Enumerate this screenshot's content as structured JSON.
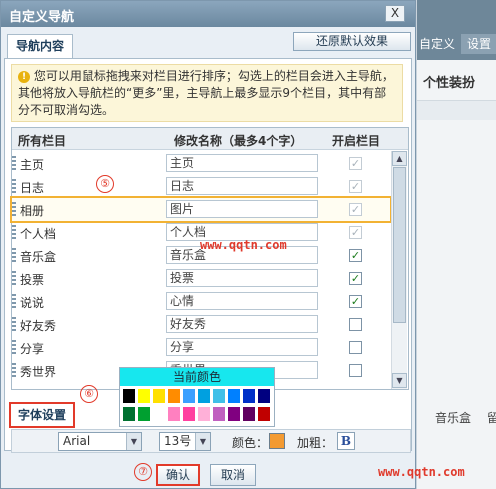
{
  "dialog": {
    "title": "自定义导航",
    "close_label": "X",
    "tab_label": "导航内容",
    "restore_label": "还原默认效果",
    "tip_icon": "!",
    "tip": "您可以用鼠标拖拽来对栏目进行排序；勾选上的栏目会进入主导航，其他将放入导航栏的“更多”里，主导航上最多显示9个栏目，其中有部分不可取消勾选。",
    "columns": {
      "all": "所有栏目",
      "rename": "修改名称（最多4个字）",
      "enable": "开启栏目"
    },
    "rows": [
      {
        "label": "主页",
        "name": "主页",
        "checked": true,
        "disabled": true
      },
      {
        "label": "日志",
        "name": "日志",
        "checked": true,
        "disabled": true
      },
      {
        "label": "相册",
        "name": "图片",
        "checked": true,
        "disabled": true,
        "highlight": true
      },
      {
        "label": "个人档",
        "name": "个人档",
        "checked": true,
        "disabled": true
      },
      {
        "label": "音乐盒",
        "name": "音乐盒",
        "checked": true,
        "disabled": false
      },
      {
        "label": "投票",
        "name": "投票",
        "checked": true,
        "disabled": false
      },
      {
        "label": "说说",
        "name": "心情",
        "checked": true,
        "disabled": false
      },
      {
        "label": "好友秀",
        "name": "好友秀",
        "checked": false,
        "disabled": false
      },
      {
        "label": "分享",
        "name": "分享",
        "checked": false,
        "disabled": false
      },
      {
        "label": "秀世界",
        "name": "秀世界",
        "checked": false,
        "disabled": false
      }
    ],
    "font_settings_label": "字体设置",
    "font_family": "Arial",
    "font_size": "13号",
    "color_label": "颜色：",
    "bold_label": "加粗：",
    "bold_button": "B",
    "current_color_label": "当前颜色",
    "palette_row1": [
      "#000000",
      "#ffff00",
      "#ffe000",
      "#ff8c00",
      "#3aa0ff",
      "#00a0e0",
      "#40c0e8",
      "#0080ff",
      "#0030c8",
      "#000080"
    ],
    "palette_row2": [
      "#007030",
      "#00a030",
      "#ffffff",
      "#ff80c0",
      "#ff40a0",
      "#ffb0d8",
      "#c060c0",
      "#800080",
      "#600060",
      "#c00000"
    ],
    "selected_color": "#f39a31",
    "ok_label": "确认",
    "cancel_label": "取消"
  },
  "steps": {
    "five": "⑤",
    "six": "⑥",
    "seven": "⑦"
  },
  "watermark": "www.qqtn.com",
  "background_page": {
    "nav_custom": "自定义",
    "nav_settings": "设置",
    "heading": "个性装扮",
    "music": "音乐盒",
    "music_more": "留"
  }
}
